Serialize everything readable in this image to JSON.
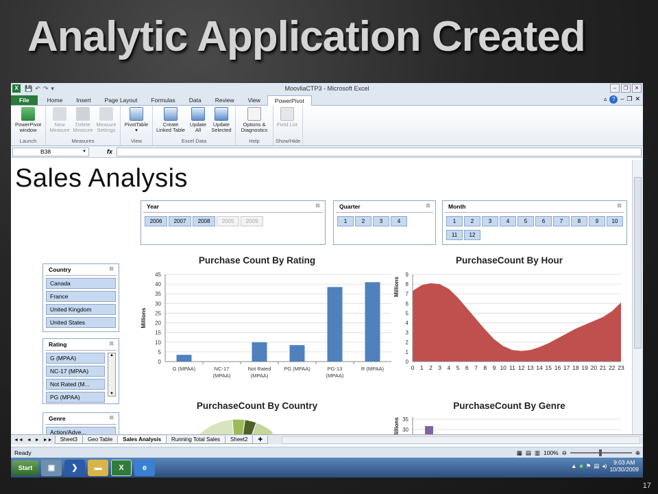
{
  "slide": {
    "title": "Analytic Application Created",
    "number": "17"
  },
  "window": {
    "title": "MoovliaCTP3 - Microsoft Excel",
    "app_icon": "X"
  },
  "tabs": [
    {
      "label": "File"
    },
    {
      "label": "Home"
    },
    {
      "label": "Insert"
    },
    {
      "label": "Page Layout"
    },
    {
      "label": "Formulas"
    },
    {
      "label": "Data"
    },
    {
      "label": "Review"
    },
    {
      "label": "View"
    },
    {
      "label": "PowerPivot"
    }
  ],
  "ribbon": {
    "groups": [
      {
        "label": "Launch",
        "buttons": [
          "PowerPivot window"
        ]
      },
      {
        "label": "Measures",
        "buttons": [
          "New Measure",
          "Delete Measure",
          "Measure Settings"
        ]
      },
      {
        "label": "View",
        "buttons": [
          "PivotTable"
        ]
      },
      {
        "label": "Excel Data",
        "buttons": [
          "Create Linked Table",
          "Update All",
          "Update Selected"
        ]
      },
      {
        "label": "Help",
        "buttons": [
          "Options & Diagnostics"
        ]
      },
      {
        "label": "Show/Hide",
        "buttons": [
          "Field List"
        ]
      }
    ]
  },
  "formula_bar": {
    "name_box": "B38",
    "fx": "fx",
    "formula": ""
  },
  "sheet": {
    "title": "Sales Analysis"
  },
  "slicers": {
    "year": {
      "title": "Year",
      "items": [
        "2006",
        "2007",
        "2008",
        "2005",
        "2009"
      ],
      "disabled": [
        "2005",
        "2009"
      ]
    },
    "quarter": {
      "title": "Quarter",
      "items": [
        "1",
        "2",
        "3",
        "4"
      ]
    },
    "month": {
      "title": "Month",
      "items": [
        "1",
        "2",
        "3",
        "4",
        "5",
        "6",
        "7",
        "8",
        "9",
        "10",
        "11",
        "12"
      ]
    },
    "country": {
      "title": "Country",
      "items": [
        "Canada",
        "France",
        "United Kingdom",
        "United States"
      ]
    },
    "rating": {
      "title": "Rating",
      "items": [
        "G (MPAA)",
        "NC-17 (MPAA)",
        "Not Rated (M...",
        "PG (MPAA)"
      ]
    },
    "genre": {
      "title": "Genre",
      "items": [
        "Action/Adve..."
      ]
    }
  },
  "chart_data": [
    {
      "type": "bar",
      "title": "Purchase Count By Rating",
      "ylabel": "Millions",
      "categories": [
        "G (MPAA)",
        "NC-17 (MPAA)",
        "Not Rated (MPAA)",
        "PG (MPAA)",
        "PG-13 (MPAA)",
        "R (MPAA)"
      ],
      "values": [
        3.5,
        0,
        10,
        8.5,
        38.5,
        41
      ],
      "ylim": [
        0,
        45
      ],
      "yticks": [
        0,
        5,
        10,
        15,
        20,
        25,
        30,
        35,
        40,
        45
      ],
      "color": "#4f81bd"
    },
    {
      "type": "area",
      "title": "PurchaseCount By Hour",
      "ylabel": "Millions",
      "x": [
        0,
        1,
        2,
        3,
        4,
        5,
        6,
        7,
        8,
        9,
        10,
        11,
        12,
        13,
        14,
        15,
        16,
        17,
        18,
        19,
        20,
        21,
        22,
        23
      ],
      "values": [
        7.3,
        7.9,
        8.1,
        8.0,
        7.5,
        6.6,
        5.5,
        4.4,
        3.3,
        2.3,
        1.6,
        1.2,
        1.1,
        1.2,
        1.5,
        1.9,
        2.4,
        2.9,
        3.4,
        3.8,
        4.2,
        4.6,
        5.2,
        6.1
      ],
      "ylim": [
        0,
        9
      ],
      "yticks": [
        0,
        1,
        2,
        3,
        4,
        5,
        6,
        7,
        8,
        9
      ],
      "color": "#c0504d"
    },
    {
      "type": "pie",
      "title": "PurchaseCount By Country"
    },
    {
      "type": "bar",
      "title": "PurchaseCount By Genre",
      "ylabel": "Millions",
      "yticks": [
        30,
        35
      ],
      "color": "#8064a2"
    }
  ],
  "sheet_tabs": [
    "Sheet3",
    "Geo Table",
    "Sales Analysis",
    "Running Total Sales",
    "Sheet2"
  ],
  "active_sheet": "Sales Analysis",
  "status": {
    "ready": "Ready",
    "zoom": "100%"
  },
  "taskbar": {
    "start": "Start",
    "time": "9:03 AM",
    "date": "10/30/2009"
  }
}
